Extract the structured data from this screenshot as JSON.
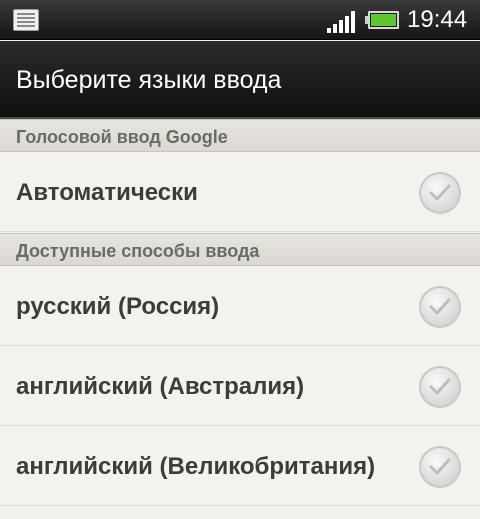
{
  "status_bar": {
    "time": "19:44",
    "icons": [
      "notification-icon",
      "signal-icon",
      "battery-icon"
    ]
  },
  "header": {
    "title": "Выберите языки ввода"
  },
  "sections": [
    {
      "title": "Голосовой ввод Google",
      "items": [
        {
          "label": "Автоматически",
          "checked": false
        }
      ]
    },
    {
      "title": "Доступные способы ввода",
      "items": [
        {
          "label": "русский (Россия)",
          "checked": false
        },
        {
          "label": "английский (Австралия)",
          "checked": false
        },
        {
          "label": "английский (Великобритания)",
          "checked": false
        }
      ]
    }
  ],
  "colors": {
    "background": "#f3f1ec",
    "title_bar": "#151515",
    "section_header": "#dfdcd5",
    "item_text": "#3c3c3c",
    "battery_green": "#5cc72e"
  }
}
